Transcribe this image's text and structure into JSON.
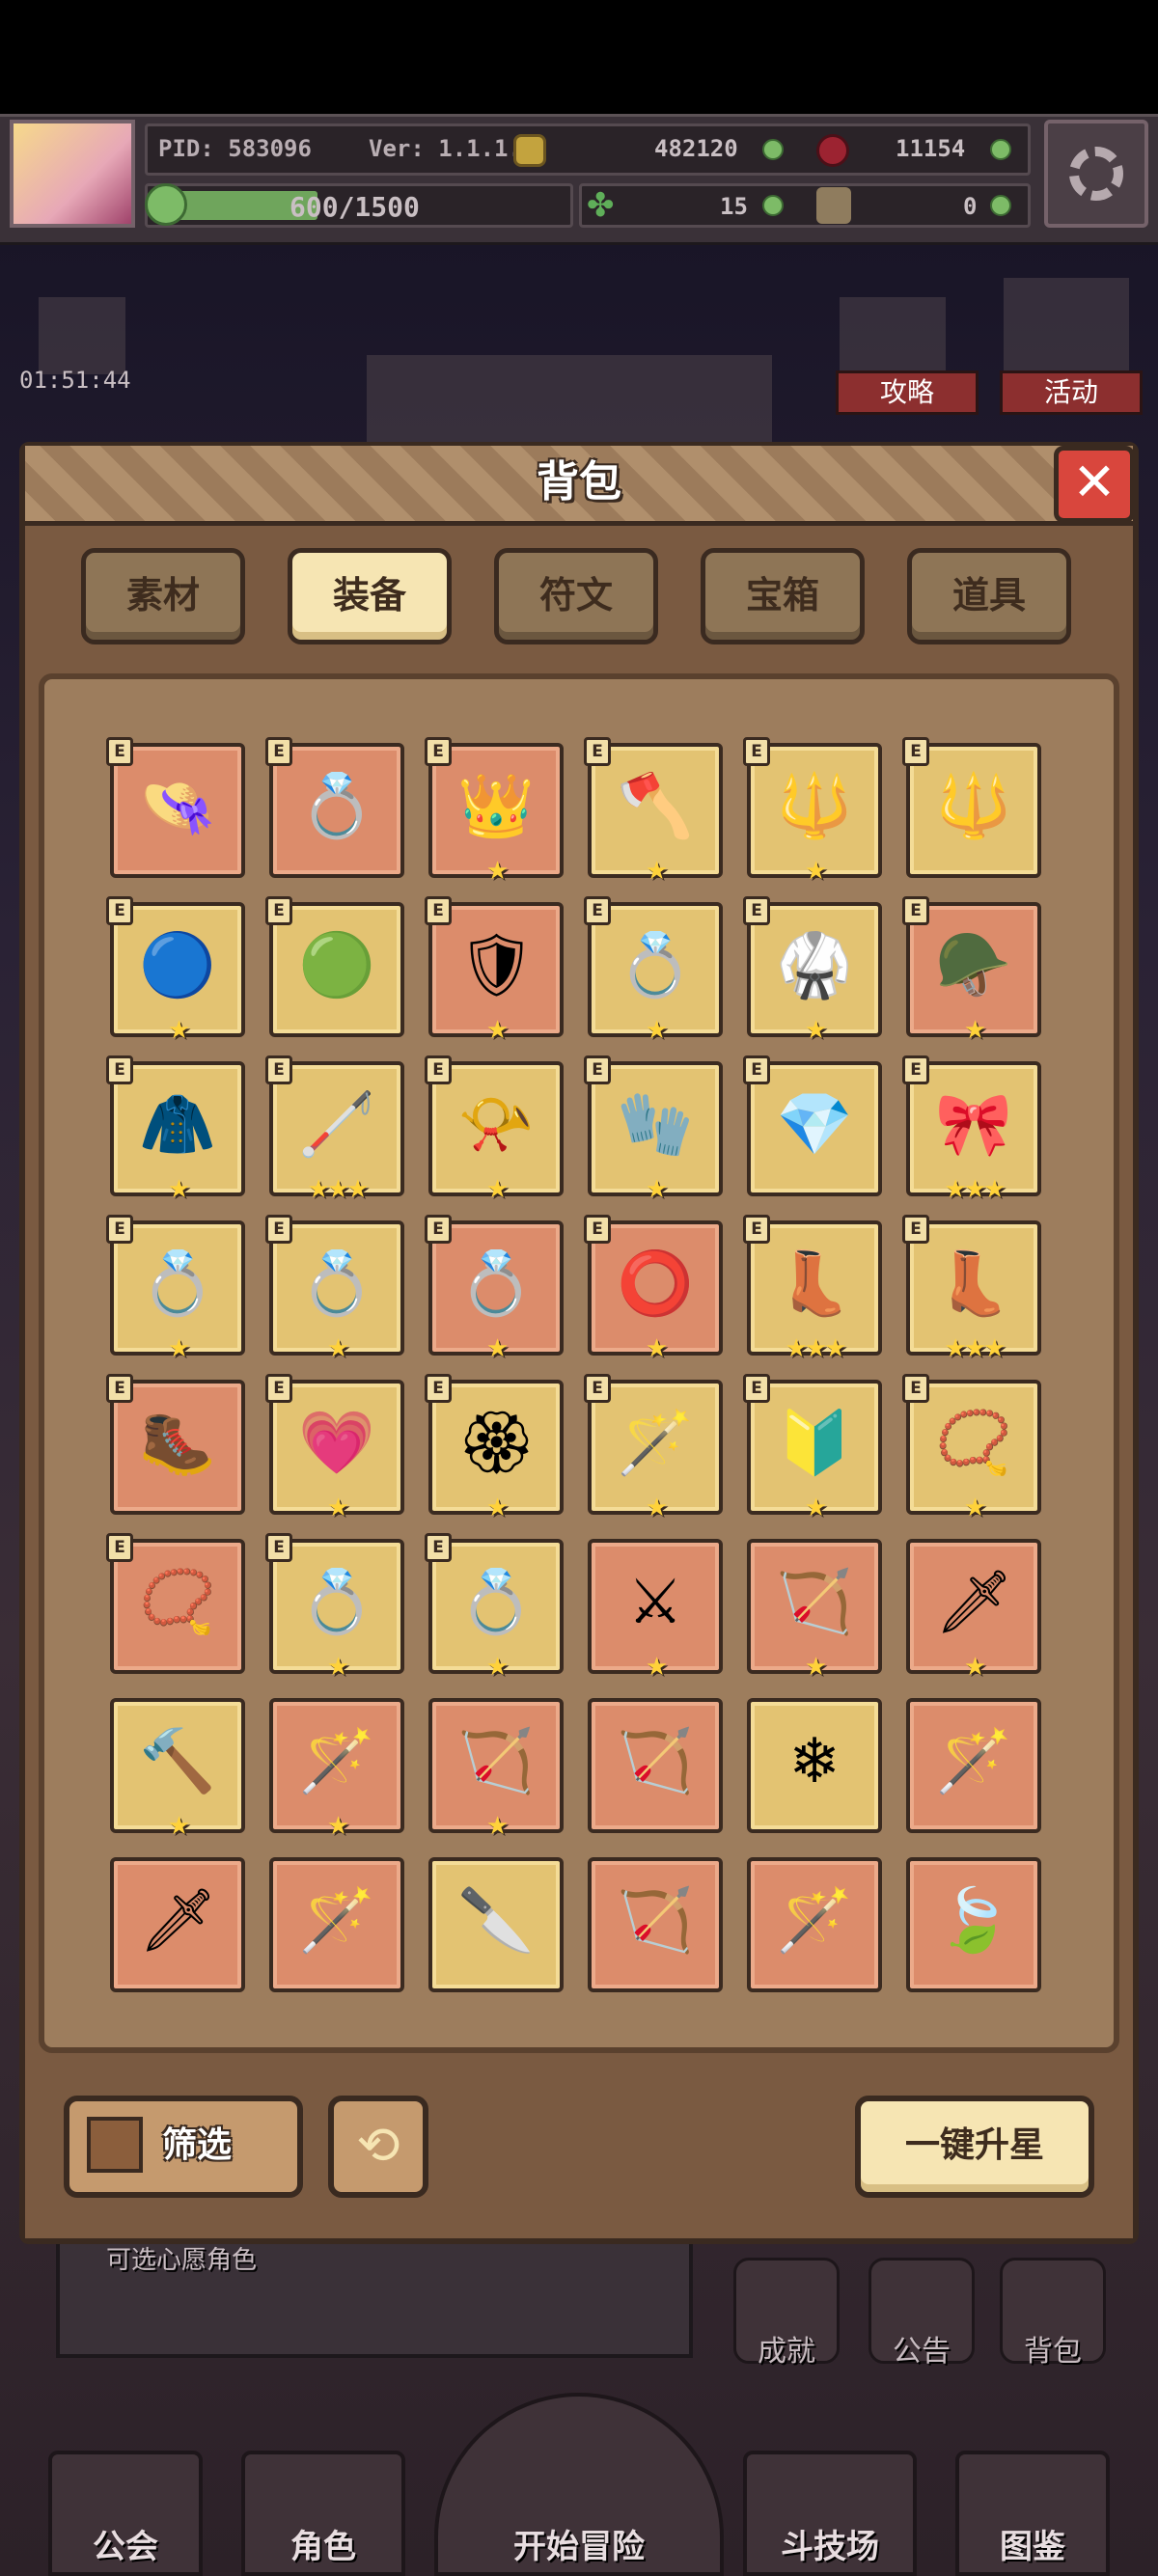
{
  "hud": {
    "pid": "PID: 583096",
    "version": "Ver: 1.1.1.4",
    "gold": "482120",
    "gems": "11154",
    "energy": "600/1500",
    "energy_progress": 0.4,
    "clover": "15",
    "key_count": "0",
    "timer": "01:51:44",
    "guide_label": "攻略",
    "event_label": "活动"
  },
  "modal": {
    "title": "背包",
    "close_symbol": "✕",
    "tabs": [
      {
        "label": "素材",
        "active": false
      },
      {
        "label": "装备",
        "active": true
      },
      {
        "label": "符文",
        "active": false
      },
      {
        "label": "宝箱",
        "active": false
      },
      {
        "label": "道具",
        "active": false
      }
    ],
    "badge": "E",
    "items": [
      {
        "icon": "straw-hat-icon",
        "glyph": "👒",
        "bg": "red",
        "stars": 0,
        "equipped": true
      },
      {
        "icon": "ring-icon",
        "glyph": "💍",
        "bg": "red",
        "stars": 0,
        "equipped": true
      },
      {
        "icon": "crown-icon",
        "glyph": "👑",
        "bg": "red",
        "stars": 1,
        "equipped": true
      },
      {
        "icon": "axe-icon",
        "glyph": "🪓",
        "bg": "gold",
        "stars": 1,
        "equipped": true
      },
      {
        "icon": "staff-icon",
        "glyph": "🔱",
        "bg": "gold",
        "stars": 1,
        "equipped": true
      },
      {
        "icon": "trident-icon",
        "glyph": "🔱",
        "bg": "gold",
        "stars": 0,
        "equipped": true
      },
      {
        "icon": "blue-orb-icon",
        "glyph": "🔵",
        "bg": "gold",
        "stars": 1,
        "equipped": true
      },
      {
        "icon": "dark-orb-icon",
        "glyph": "🟢",
        "bg": "gold",
        "stars": 0,
        "equipped": true
      },
      {
        "icon": "golden-armor-icon",
        "glyph": "🛡",
        "bg": "red",
        "stars": 1,
        "equipped": true
      },
      {
        "icon": "crown-ring-icon",
        "glyph": "💍",
        "bg": "gold",
        "stars": 1,
        "equipped": true
      },
      {
        "icon": "green-armor-icon",
        "glyph": "🥋",
        "bg": "gold",
        "stars": 1,
        "equipped": true
      },
      {
        "icon": "horned-helmet-icon",
        "glyph": "🪖",
        "bg": "red",
        "stars": 1,
        "equipped": true
      },
      {
        "icon": "cape-icon",
        "glyph": "🧥",
        "bg": "gold",
        "stars": 1,
        "equipped": true
      },
      {
        "icon": "gold-bracer-icon",
        "glyph": "🦯",
        "bg": "gold",
        "stars": 3,
        "equipped": true
      },
      {
        "icon": "gold-horn-icon",
        "glyph": "📯",
        "bg": "gold",
        "stars": 1,
        "equipped": true
      },
      {
        "icon": "gauntlet-icon",
        "glyph": "🧤",
        "bg": "gold",
        "stars": 1,
        "equipped": true
      },
      {
        "icon": "crystal-shield-icon",
        "glyph": "💎",
        "bg": "gold",
        "stars": 0,
        "equipped": true
      },
      {
        "icon": "gold-belt-icon",
        "glyph": "🎀",
        "bg": "gold",
        "stars": 3,
        "equipped": true
      },
      {
        "icon": "gold-ring-icon",
        "glyph": "💍",
        "bg": "gold",
        "stars": 1,
        "equipped": true
      },
      {
        "icon": "emerald-ring-icon",
        "glyph": "💍",
        "bg": "gold",
        "stars": 1,
        "equipped": true
      },
      {
        "icon": "ruby-ring-icon",
        "glyph": "💍",
        "bg": "red",
        "stars": 1,
        "equipped": true
      },
      {
        "icon": "iron-ring-icon",
        "glyph": "⭕",
        "bg": "red",
        "stars": 1,
        "equipped": true
      },
      {
        "icon": "gold-boots-icon",
        "glyph": "👢",
        "bg": "gold",
        "stars": 3,
        "equipped": true
      },
      {
        "icon": "red-boots-icon",
        "glyph": "👢",
        "bg": "gold",
        "stars": 3,
        "equipped": true
      },
      {
        "icon": "iron-boots-icon",
        "glyph": "🥾",
        "bg": "red",
        "stars": 0,
        "equipped": true
      },
      {
        "icon": "heart-amulet-icon",
        "glyph": "💗",
        "bg": "gold",
        "stars": 1,
        "equipped": true
      },
      {
        "icon": "gold-medal-icon",
        "glyph": "🏵",
        "bg": "gold",
        "stars": 1,
        "equipped": true
      },
      {
        "icon": "wooden-wand-icon",
        "glyph": "🪄",
        "bg": "gold",
        "stars": 1,
        "equipped": true
      },
      {
        "icon": "blue-crest-icon",
        "glyph": "🔰",
        "bg": "gold",
        "stars": 1,
        "equipped": true
      },
      {
        "icon": "gold-necklace-icon",
        "glyph": "📿",
        "bg": "gold",
        "stars": 1,
        "equipped": true
      },
      {
        "icon": "pendant-icon",
        "glyph": "📿",
        "bg": "red",
        "stars": 0,
        "equipped": true
      },
      {
        "icon": "jewel-ring-icon",
        "glyph": "💍",
        "bg": "gold",
        "stars": 1,
        "equipped": true
      },
      {
        "icon": "gem-ring-icon",
        "glyph": "💍",
        "bg": "gold",
        "stars": 1,
        "equipped": true
      },
      {
        "icon": "crossed-swords-icon",
        "glyph": "⚔",
        "bg": "red",
        "stars": 1,
        "equipped": false
      },
      {
        "icon": "crossbow-icon",
        "glyph": "🏹",
        "bg": "red",
        "stars": 1,
        "equipped": false
      },
      {
        "icon": "silver-sword-icon",
        "glyph": "🗡",
        "bg": "red",
        "stars": 1,
        "equipped": false
      },
      {
        "icon": "green-mace-icon",
        "glyph": "🔨",
        "bg": "gold",
        "stars": 1,
        "equipped": false
      },
      {
        "icon": "blue-staff-icon",
        "glyph": "🪄",
        "bg": "red",
        "stars": 1,
        "equipped": false
      },
      {
        "icon": "gold-bow-icon",
        "glyph": "🏹",
        "bg": "red",
        "stars": 1,
        "equipped": false
      },
      {
        "icon": "jade-bow-icon",
        "glyph": "🏹",
        "bg": "red",
        "stars": 0,
        "equipped": false
      },
      {
        "icon": "ice-wand-icon",
        "glyph": "❄",
        "bg": "gold",
        "stars": 0,
        "equipped": false
      },
      {
        "icon": "gold-scepter-icon",
        "glyph": "🪄",
        "bg": "red",
        "stars": 0,
        "equipped": false
      },
      {
        "icon": "green-sword-icon",
        "glyph": "🗡",
        "bg": "red",
        "stars": 0,
        "equipped": false
      },
      {
        "icon": "wooden-scepter-icon",
        "glyph": "🪄",
        "bg": "red",
        "stars": 0,
        "equipped": false
      },
      {
        "icon": "steel-spear-icon",
        "glyph": "🔪",
        "bg": "gold",
        "stars": 0,
        "equipped": false
      },
      {
        "icon": "iron-crossbow-icon",
        "glyph": "🏹",
        "bg": "red",
        "stars": 0,
        "equipped": false
      },
      {
        "icon": "claw-staff-icon",
        "glyph": "🪄",
        "bg": "red",
        "stars": 0,
        "equipped": false
      },
      {
        "icon": "leaf-blade-icon",
        "glyph": "🍃",
        "bg": "red",
        "stars": 0,
        "equipped": false
      }
    ],
    "filter_label": "筛选",
    "refresh_symbol": "⟲",
    "upgrade_label": "一键升星"
  },
  "background": {
    "banner_text": "可选心愿角色",
    "side_buttons": [
      "成就",
      "公告",
      "背包"
    ],
    "nav": [
      "公会",
      "角色",
      "开始冒险",
      "斗技场",
      "图鉴"
    ]
  },
  "colors": {
    "cell_gold": "#e3c372",
    "cell_red": "#dc8c6b",
    "star": "#ffd23a",
    "tab_active": "#f6e5b3",
    "close_red": "#d9463d"
  }
}
